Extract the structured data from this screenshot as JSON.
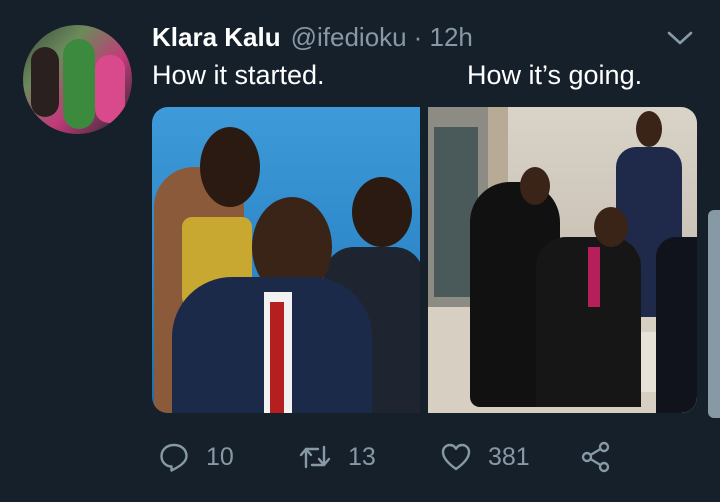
{
  "tweet": {
    "author_name": "Klara Kalu",
    "handle": "@ifedioku",
    "time": "· 12h",
    "text_left": "How it started.",
    "text_right": "How it’s going."
  },
  "actions": {
    "replies": "10",
    "retweets": "13",
    "likes": "381"
  },
  "colors": {
    "background": "#15202b",
    "secondary_text": "#8899a6",
    "primary_text": "#ffffff"
  },
  "icons": [
    "reply-icon",
    "retweet-icon",
    "like-icon",
    "share-icon",
    "chevron-down-icon"
  ]
}
